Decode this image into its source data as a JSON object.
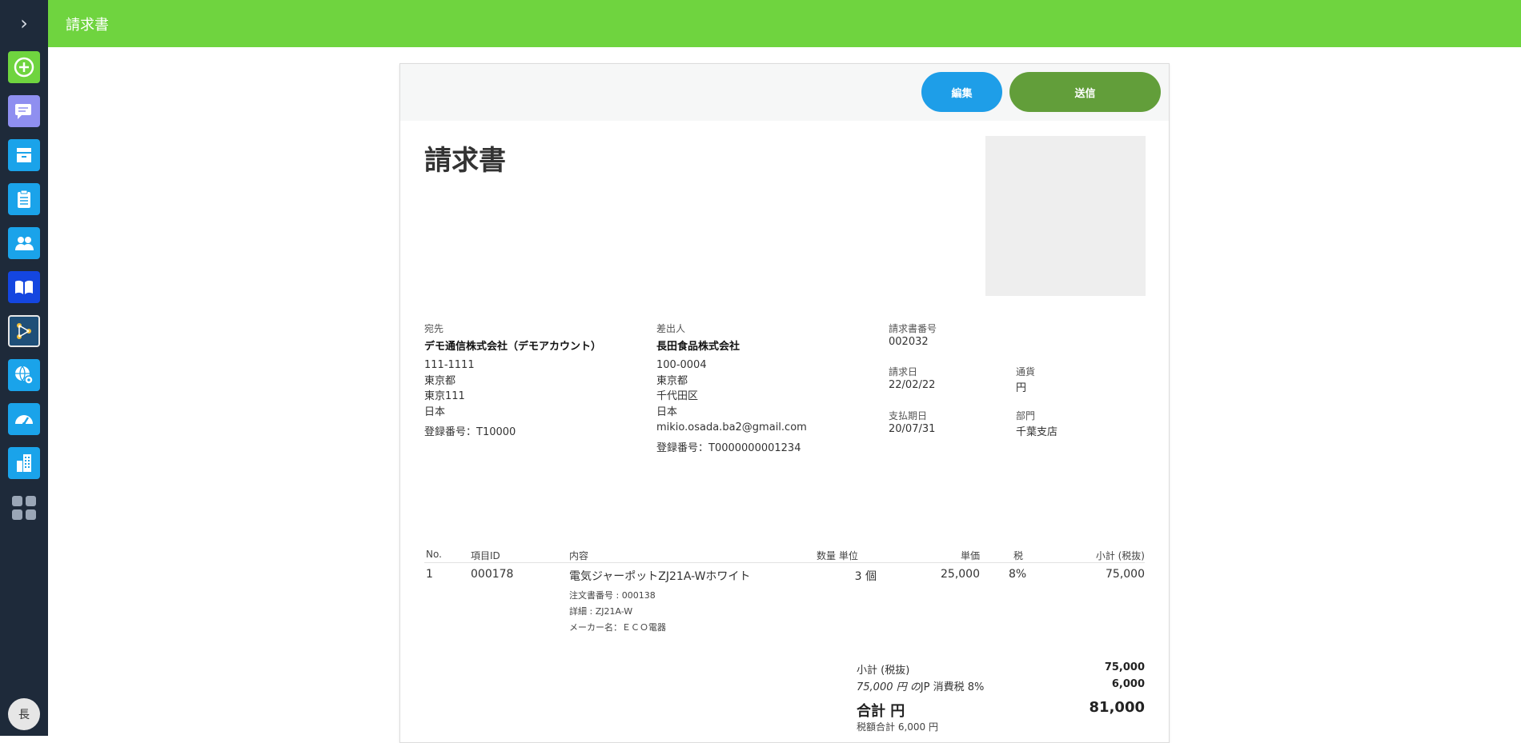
{
  "header": {
    "title": "請求書"
  },
  "sidebar": {
    "toggle_icon": "chevron-right-icon",
    "items": [
      {
        "name": "add",
        "icon": "plus-circle-icon",
        "color": "#6fd43f"
      },
      {
        "name": "messages",
        "icon": "chat-icon",
        "color": "#8f8ff0"
      },
      {
        "name": "archive",
        "icon": "inbox-icon",
        "color": "#1aa3ea"
      },
      {
        "name": "clipboard",
        "icon": "clipboard-icon",
        "color": "#1aa3ea"
      },
      {
        "name": "contacts",
        "icon": "users-icon",
        "color": "#1aa3ea"
      },
      {
        "name": "book",
        "icon": "book-icon",
        "color": "#1446e0"
      },
      {
        "name": "workflow",
        "icon": "share-nodes-icon",
        "color": "#1f4f78"
      },
      {
        "name": "global-settings",
        "icon": "globe-gear-icon",
        "color": "#1aa3ea"
      },
      {
        "name": "dashboard",
        "icon": "speedometer-icon",
        "color": "#1aa3ea"
      },
      {
        "name": "organization",
        "icon": "building-icon",
        "color": "#1aa3ea"
      }
    ],
    "apps_icon": "grid-icon",
    "avatar_label": "長"
  },
  "toolbar": {
    "edit_label": "編集",
    "send_label": "送信"
  },
  "invoice": {
    "title": "請求書",
    "recipient": {
      "label": "宛先",
      "name": "デモ通信株式会社（デモアカウント）",
      "address_lines": [
        "111-1111",
        "東京都",
        "東京111",
        "日本"
      ],
      "registration": "登録番号：T10000"
    },
    "sender": {
      "label": "差出人",
      "name": "長田食品株式会社",
      "address_lines": [
        "100-0004",
        "東京都",
        "千代田区",
        "日本",
        "mikio.osada.ba2@gmail.com"
      ],
      "registration": "登録番号：T0000000001234"
    },
    "meta": {
      "number_label": "請求書番号",
      "number": "002032",
      "issue_date_label": "請求日",
      "issue_date": "22/02/22",
      "currency_label": "通貨",
      "currency": "円",
      "due_date_label": "支払期日",
      "due_date": "20/07/31",
      "department_label": "部門",
      "department": "千葉支店"
    },
    "table": {
      "headers": {
        "no": "No.",
        "item_id": "項目ID",
        "content": "内容",
        "qty_unit": "数量 単位",
        "unit_price": "単価",
        "tax": "税",
        "subtotal": "小計 (税抜)"
      },
      "rows": [
        {
          "no": "1",
          "item_id": "000178",
          "content": "電気ジャーポットZJ21A-Wホワイト",
          "qty": "3 個",
          "unit_price": "25,000",
          "tax": "8%",
          "subtotal": "75,000",
          "details": [
            "注文書番号 : 000138",
            "詳細 : ZJ21A-W",
            "メーカー名：ＥＣＯ電器"
          ]
        }
      ]
    },
    "totals": {
      "subtotal_label": "小計 (税抜)",
      "subtotal": "75,000",
      "tax_label_prefix": "75,000 円 の",
      "tax_label_suffix": "JP 消費税 8%",
      "tax": "6,000",
      "total_label": "合計 円",
      "total": "81,000",
      "tax_total_note": "税額合計 6,000 円"
    }
  }
}
